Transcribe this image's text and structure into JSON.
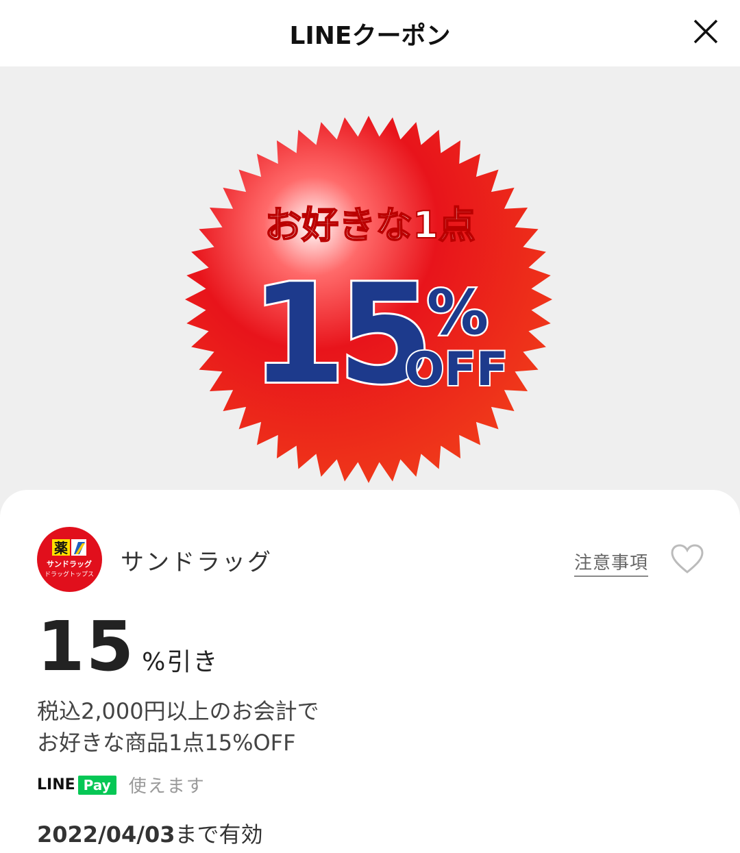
{
  "header": {
    "title": "LINEクーポン",
    "close_icon": "close-icon"
  },
  "banner": {
    "line1": "お好きな1点",
    "big_number": "15",
    "percent": "%",
    "off": "OFF",
    "colors": {
      "burst": "#e8141b",
      "number": "#1d3a8c",
      "background": "#efefef"
    }
  },
  "store": {
    "name": "サンドラッグ",
    "logo_kanji": "薬",
    "logo_text1": "サンドラッグ",
    "logo_text2": "ドラッグトップス",
    "notes_label": "注意事項",
    "favorite_icon": "heart-outline-icon"
  },
  "discount": {
    "value": "15",
    "unit": "%引き"
  },
  "description": {
    "line1": "税込2,000円以上のお会計で",
    "line2": "お好きな商品1点15%OFF"
  },
  "payment": {
    "brand_line": "LINE",
    "brand_pay": "Pay",
    "status": "使えます",
    "brand_color": "#06c755"
  },
  "validity": {
    "date": "2022/04/03",
    "suffix": "まで有効"
  }
}
